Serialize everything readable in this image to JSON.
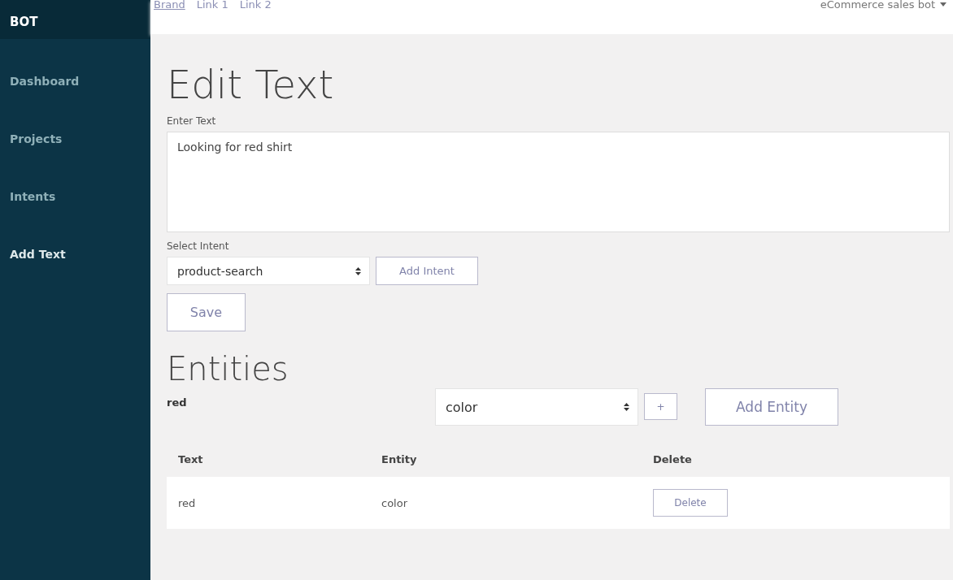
{
  "sidebar": {
    "brand": "BOT",
    "items": [
      {
        "label": "Dashboard",
        "selected": false
      },
      {
        "label": "Projects",
        "selected": false
      },
      {
        "label": "Intents",
        "selected": false
      },
      {
        "label": "Add Text",
        "selected": true
      }
    ]
  },
  "navbar": {
    "links": [
      "Brand",
      "Link 1",
      "Link 2"
    ],
    "account": "eCommerce sales bot"
  },
  "title": "Edit Text",
  "text_field": {
    "label": "Enter Text",
    "value": "Looking for red shirt"
  },
  "intent": {
    "label": "Select Intent",
    "value": "product-search",
    "add_button": "Add Intent"
  },
  "save_button": "Save",
  "entities": {
    "heading": "Entities",
    "selected_text": "red",
    "entity_select": "color",
    "plus_button": "+",
    "add_button": "Add Entity",
    "columns": [
      "Text",
      "Entity",
      "Delete"
    ],
    "rows": [
      {
        "text": "red",
        "entity": "color",
        "action": "Delete"
      }
    ]
  }
}
